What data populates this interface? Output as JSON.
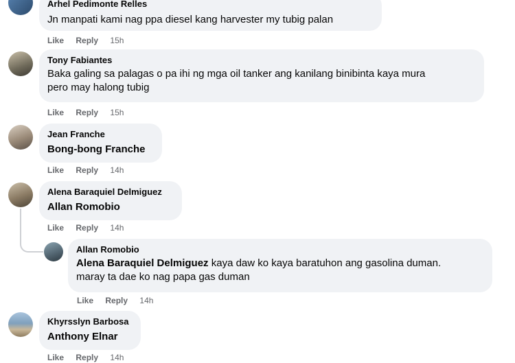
{
  "comments": [
    {
      "author": "Arhel Pedimonte Relles",
      "text": "Jn manpati kami nag ppa diesel kang harvester my tubig palan",
      "like": "Like",
      "reply": "Reply",
      "time": "15h"
    },
    {
      "author": "Tony Fabiantes",
      "text_line1": "Baka galing sa palagas o pa ihi ng mga oil tanker ang kanilang binibinta kaya mura",
      "text_line2": "pero may halong tubig",
      "like": "Like",
      "reply": "Reply",
      "time": "15h"
    },
    {
      "author": "Jean Franche",
      "tag": "Bong-bong Franche",
      "like": "Like",
      "reply": "Reply",
      "time": "14h"
    },
    {
      "author": "Alena Baraquiel Delmiguez",
      "tag": "Allan Romobio",
      "like": "Like",
      "reply": "Reply",
      "time": "14h"
    },
    {
      "author": "Allan Romobio",
      "tag": "Alena Baraquiel Delmiguez",
      "text_line1": " kaya daw ko kaya baratuhon ang gasolina duman.",
      "text_line2": "maray ta dae ko nag papa gas duman",
      "like": "Like",
      "reply": "Reply",
      "time": "14h"
    },
    {
      "author": "Khyrsslyn Barbosa",
      "tag": "Anthony Elnar",
      "like": "Like",
      "reply": "Reply",
      "time": "14h"
    }
  ],
  "icons": {
    "avatar": "user-avatar-photo"
  }
}
